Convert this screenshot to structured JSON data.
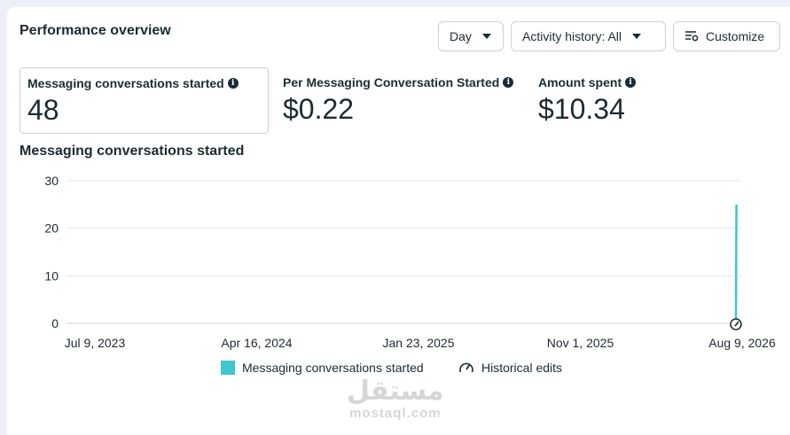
{
  "header": {
    "title": "Performance overview",
    "day_label": "Day",
    "activity_label": "Activity history: All",
    "customize_label": "Customize"
  },
  "metrics": [
    {
      "label": "Messaging conversations started",
      "value": "48"
    },
    {
      "label": "Per Messaging Conversation Started",
      "value": "$0.22"
    },
    {
      "label": "Amount spent",
      "value": "$10.34"
    }
  ],
  "chart_title": "Messaging conversations started",
  "chart_data": {
    "type": "line",
    "title": "Messaging conversations started",
    "xlabel": "",
    "ylabel": "",
    "ylim": [
      0,
      30
    ],
    "yticks": [
      "0",
      "10",
      "20",
      "30"
    ],
    "xticks": [
      "Jul 9, 2023",
      "Apr 16, 2024",
      "Jan 23, 2025",
      "Nov 1, 2025",
      "Aug 9, 2026"
    ],
    "grid": true,
    "series": [
      {
        "name": "Messaging conversations started",
        "color": "#3ec7cd",
        "points": [
          {
            "x": "Aug 8, 2026",
            "y": 0
          },
          {
            "x": "Aug 9, 2026",
            "y": 25
          }
        ]
      }
    ]
  },
  "legend": {
    "series_label": "Messaging conversations started",
    "edits_label": "Historical edits",
    "edits_icon": "gauge-icon"
  },
  "watermark": {
    "arabic": "مستقل",
    "latin": "mostaql.com"
  }
}
